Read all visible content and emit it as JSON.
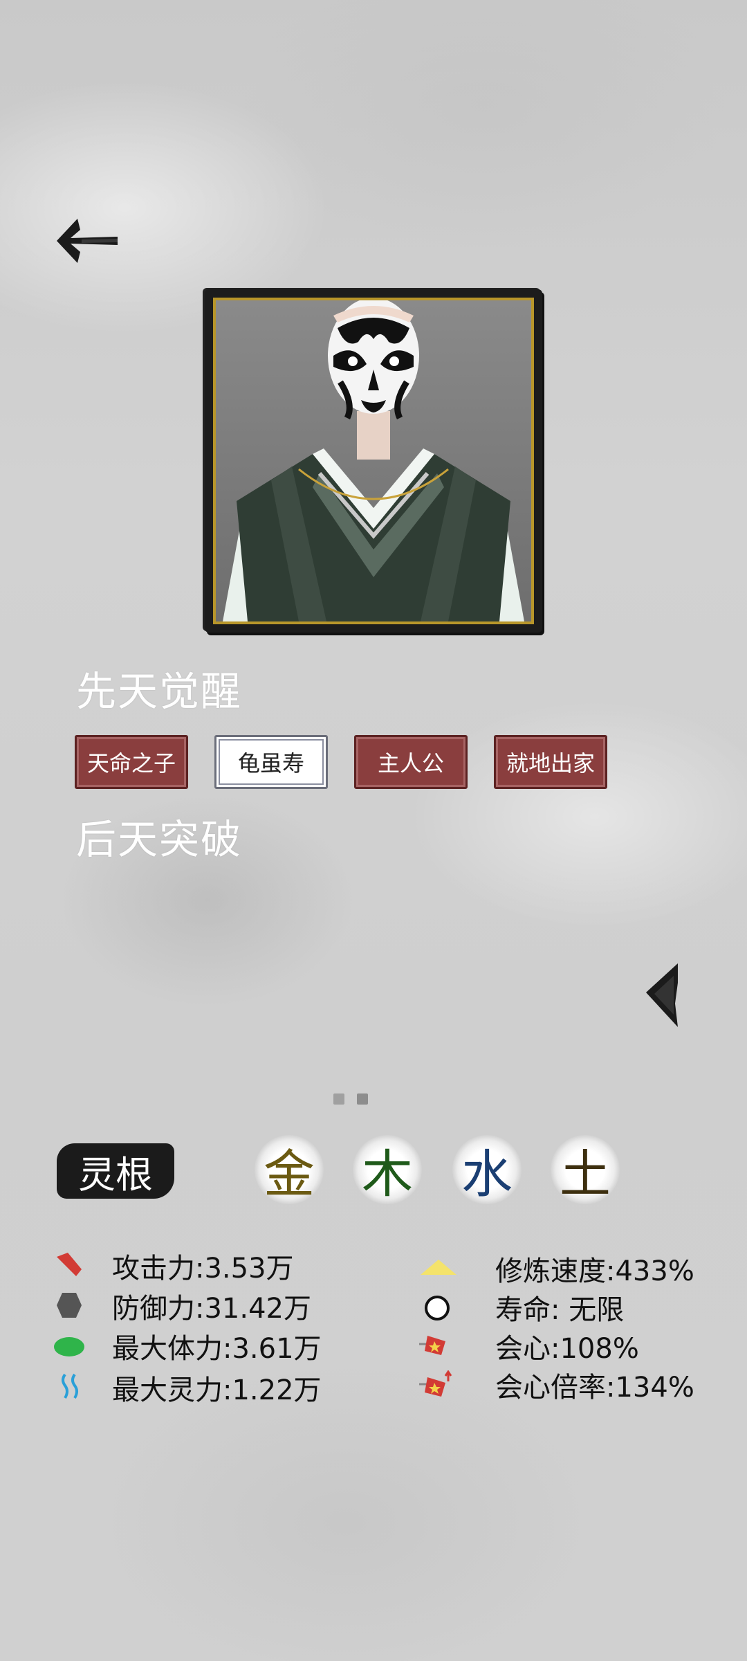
{
  "sections": {
    "innate_title": "先天觉醒",
    "acquired_title": "后天突破"
  },
  "traits": [
    {
      "label": "天命之子",
      "style": "red"
    },
    {
      "label": "龟虽寿",
      "style": "white"
    },
    {
      "label": "主人公",
      "style": "red"
    },
    {
      "label": "就地出家",
      "style": "red"
    }
  ],
  "pager": {
    "pages": 2,
    "current": 2
  },
  "spiritual_root": {
    "label": "灵根",
    "elements": [
      {
        "char": "金",
        "color": "#6b5a12"
      },
      {
        "char": "木",
        "color": "#1f5a1a"
      },
      {
        "char": "水",
        "color": "#1b3f73"
      },
      {
        "char": "土",
        "color": "#3d2f0f"
      }
    ]
  },
  "stats_left": [
    {
      "icon": "attack-icon",
      "text": "攻击力:3.53万",
      "color": "#d23b35"
    },
    {
      "icon": "defense-icon",
      "text": "防御力:31.42万",
      "color": "#555555"
    },
    {
      "icon": "health-icon",
      "text": "最大体力:3.61万",
      "color": "#2fb44a"
    },
    {
      "icon": "mana-icon",
      "text": "最大灵力:1.22万",
      "color": "#2aa0d8"
    }
  ],
  "stats_right": [
    {
      "icon": "cultivation-speed-icon",
      "text": "修炼速度:433%",
      "color": "#f4e36b"
    },
    {
      "icon": "lifespan-icon",
      "text": "寿命:  无限",
      "color": "#111111"
    },
    {
      "icon": "critical-icon",
      "text": "会心:108%",
      "color": "#d23b35"
    },
    {
      "icon": "critical-multiplier-icon",
      "text": "会心倍率:134%",
      "color": "#d23b35"
    }
  ]
}
